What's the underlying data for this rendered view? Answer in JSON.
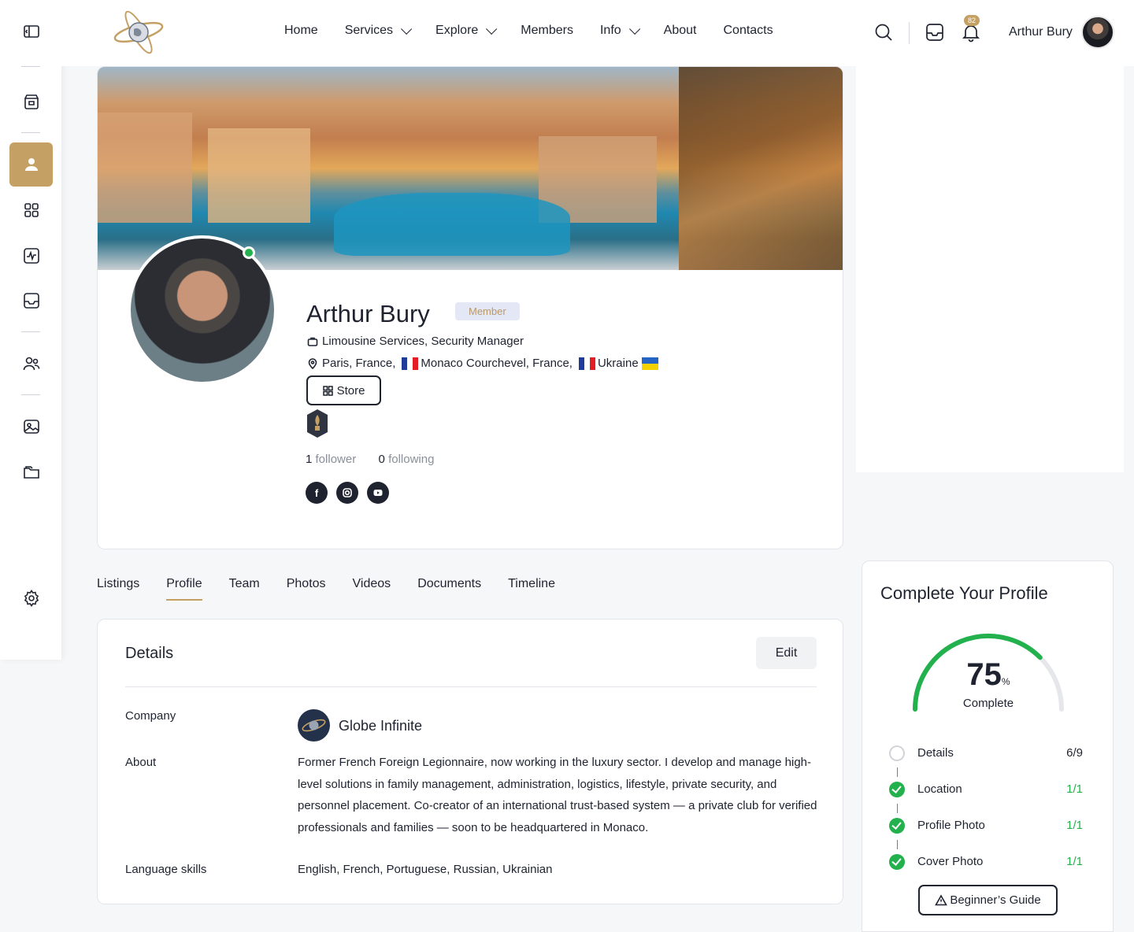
{
  "header": {
    "nav": [
      "Home",
      "Services",
      "Explore",
      "Members",
      "Info",
      "About",
      "Contacts"
    ],
    "notification_count": "82",
    "user_name": "Arthur Bury"
  },
  "sidebar": {
    "items": [
      "panel-toggle-icon",
      "store-icon",
      "profile-icon",
      "grid-icon",
      "activity-icon",
      "inbox-icon",
      "users-icon",
      "gallery-icon",
      "folder-icon",
      "settings-icon"
    ],
    "active": "profile-icon"
  },
  "profile": {
    "name": "Arthur Bury",
    "badge": "Member",
    "occupation": "Limousine Services, Security Manager",
    "location_1": "Paris, France,",
    "location_2": "Monaco Courchevel, France,",
    "location_3": "Ukraine",
    "store_label": "Store",
    "followers_count": "1",
    "followers_label": "follower",
    "following_count": "0",
    "following_label": "following",
    "social": [
      "facebook-icon",
      "instagram-icon",
      "youtube-icon"
    ]
  },
  "tabs": {
    "items": [
      "Listings",
      "Profile",
      "Team",
      "Photos",
      "Videos",
      "Documents",
      "Timeline"
    ],
    "active": "Profile"
  },
  "details": {
    "title": "Details",
    "edit_label": "Edit",
    "company_label": "Company",
    "company_name": "Globe Infinite",
    "about_label": "About",
    "about_text": "Former French Foreign Legionnaire, now working in the luxury sector. I develop and manage high-level solutions in family management, administration, logistics, lifestyle, private security, and personnel placement. Co-creator of an international trust-based system — a private club for verified professionals and families — soon to be headquartered in Monaco.",
    "language_label": "Language skills",
    "language_value": "English, French, Portuguese, Russian, Ukrainian"
  },
  "complete_profile": {
    "title": "Complete Your Profile",
    "percent": 75,
    "percent_text": "75",
    "percent_unit": "%",
    "complete_label": "Complete",
    "steps": [
      {
        "label": "Details",
        "count": "6/9",
        "done": false
      },
      {
        "label": "Location",
        "count": "1/1",
        "done": true
      },
      {
        "label": "Profile Photo",
        "count": "1/1",
        "done": true
      },
      {
        "label": "Cover Photo",
        "count": "1/1",
        "done": true
      }
    ],
    "guide_label": "Beginner’s Guide"
  },
  "colors": {
    "accent": "#c4a065",
    "success": "#22b14c",
    "text": "#1f2330"
  }
}
